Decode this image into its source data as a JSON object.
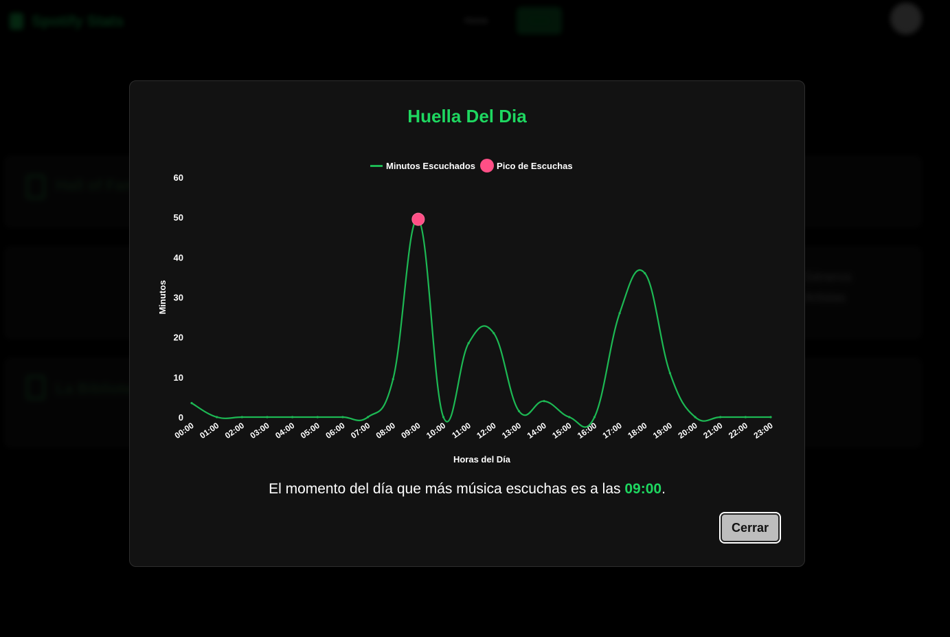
{
  "background": {
    "app_name": "Spotify Stats",
    "nav": {
      "home_label": "Home",
      "stats_label": "Stats"
    },
    "cards": [
      {
        "title": "Hall of Fame"
      },
      {
        "title": "La Biblioteca"
      }
    ],
    "side_text": [
      "Géneros",
      "Artistas"
    ]
  },
  "modal": {
    "title": "Huella Del Dia",
    "summary_prefix": "El momento del día que más música escuchas es a las ",
    "summary_time": "09:00",
    "summary_suffix": ".",
    "close_label": "Cerrar"
  },
  "chart_data": {
    "type": "line",
    "title": "Huella Del Dia",
    "xlabel": "Horas del Día",
    "ylabel": "Minutos",
    "ylim": [
      0,
      60
    ],
    "yticks": [
      0,
      10,
      20,
      30,
      40,
      50,
      60
    ],
    "categories": [
      "00:00",
      "01:00",
      "02:00",
      "03:00",
      "04:00",
      "05:00",
      "06:00",
      "07:00",
      "08:00",
      "09:00",
      "10:00",
      "11:00",
      "12:00",
      "13:00",
      "14:00",
      "15:00",
      "16:00",
      "17:00",
      "18:00",
      "19:00",
      "20:00",
      "21:00",
      "22:00",
      "23:00"
    ],
    "series": [
      {
        "name": "Minutos Escuchados",
        "color": "#1db954",
        "values": [
          3.5,
          0,
          0,
          0,
          0,
          0,
          0,
          0,
          9.5,
          49.5,
          0,
          18.5,
          21,
          1.5,
          4,
          0,
          0,
          26,
          36,
          11,
          0,
          0,
          0,
          0
        ]
      }
    ],
    "peak": {
      "name": "Pico de Escuchas",
      "category": "09:00",
      "value": 49.5,
      "color": "#ff4f86"
    },
    "legend": "top-center",
    "grid": false
  }
}
